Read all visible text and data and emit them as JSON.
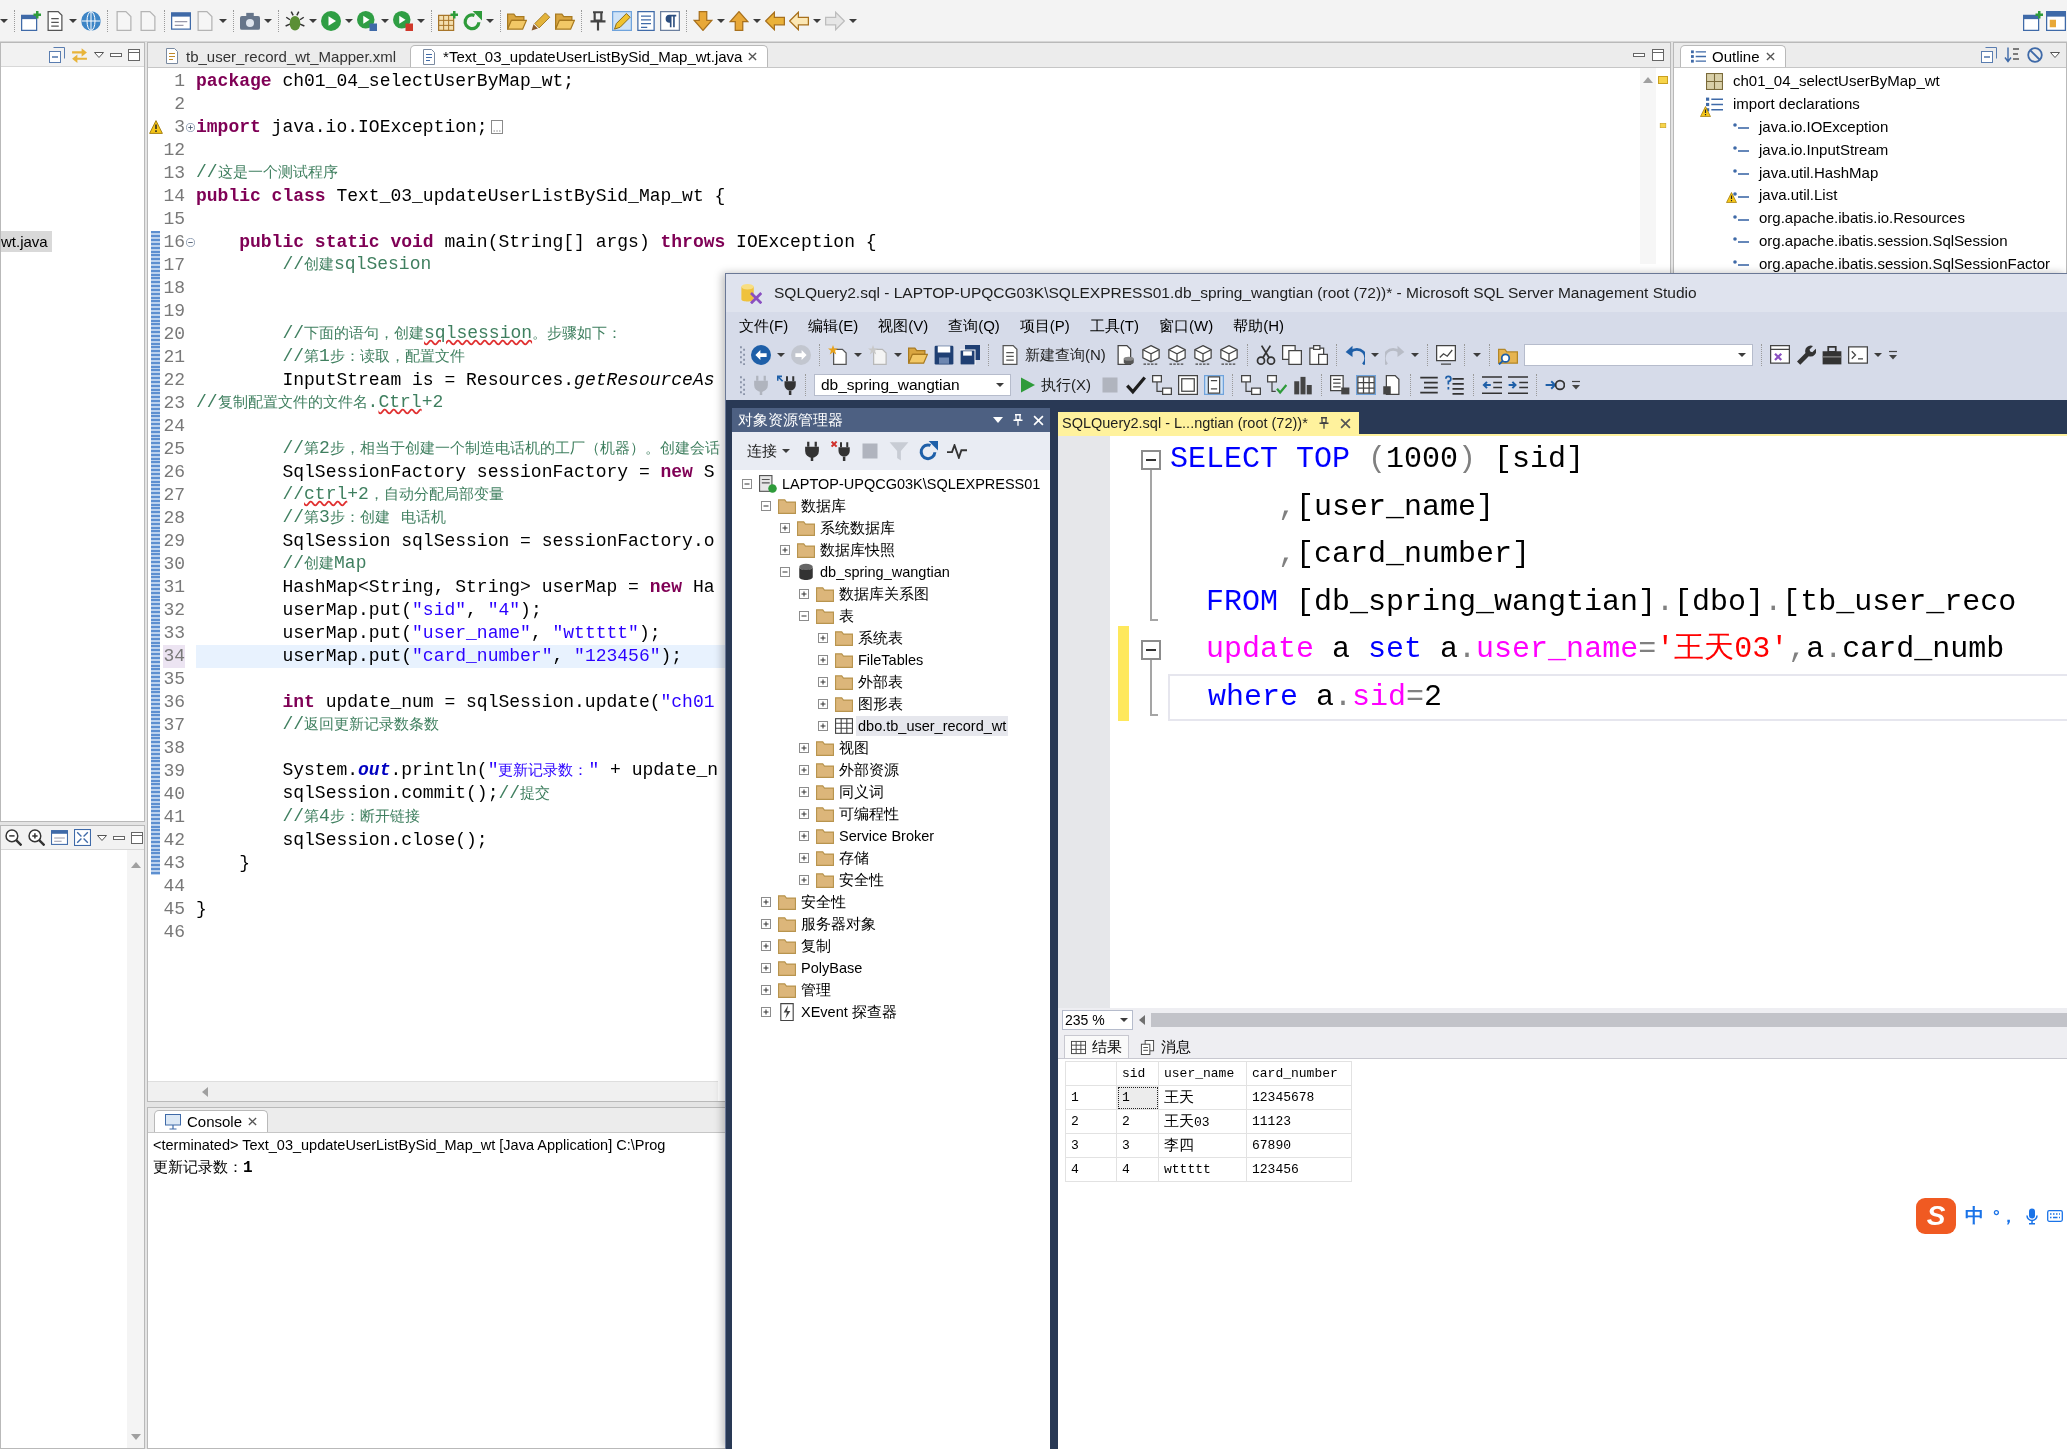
{
  "eclipse": {
    "toolbar": {
      "mark_occurrences": true
    },
    "package_explorer": {
      "items": [
        {
          "label": "wt.java",
          "selected": true
        }
      ]
    },
    "editor": {
      "tabs": [
        {
          "label": "tb_user_record_wt_Mapper.xml",
          "selected": false
        },
        {
          "label": "*Text_03_updateUserListBySid_Map_wt.java",
          "selected": true
        }
      ],
      "lines": [
        {
          "number": "1",
          "kind": "plain",
          "tokens": [
            {
              "kind": "kw",
              "text": "package"
            },
            {
              "kind": "pl",
              "text": " ch01_04_selectUserByMap_wt;"
            }
          ],
          "warning": false,
          "changed": false,
          "current": false
        },
        {
          "number": "2",
          "kind": "plain",
          "warning": false,
          "changed": false,
          "current": false
        },
        {
          "number": "3",
          "kind": "folded",
          "tokens": [
            {
              "kind": "kw",
              "text": "import"
            },
            {
              "kind": "pl",
              "text": " java.io.IOException;"
            }
          ],
          "warning": true,
          "changed": false,
          "current": false
        },
        {
          "number": "12",
          "kind": "plain",
          "warning": false,
          "changed": false,
          "current": false
        },
        {
          "number": "13",
          "kind": "plain",
          "tokens": [
            {
              "kind": "cm",
              "text": "//这是一个测试程序"
            }
          ],
          "warning": false,
          "changed": false,
          "current": false
        },
        {
          "number": "14",
          "kind": "plain",
          "tokens": [
            {
              "kind": "kw",
              "text": "public class"
            },
            {
              "kind": "pl",
              "text": " Text_03_updateUserListBySid_Map_wt {"
            }
          ],
          "warning": false,
          "changed": false,
          "current": false
        },
        {
          "number": "15",
          "kind": "plain",
          "warning": false,
          "changed": false,
          "current": false
        },
        {
          "number": "16",
          "kind": "fold",
          "tokens": [
            {
              "kind": "kw",
              "text": "    public static void"
            },
            {
              "kind": "pl",
              "text": " main(String[] args) "
            },
            {
              "kind": "kw",
              "text": "throws"
            },
            {
              "kind": "pl",
              "text": " IOException {"
            }
          ],
          "warning": false,
          "changed": true,
          "current": false
        },
        {
          "number": "17",
          "kind": "plain",
          "tokens": [
            {
              "kind": "cm",
              "text": "        //创建sqlSesion"
            }
          ],
          "warning": false,
          "changed": true,
          "current": false
        },
        {
          "number": "18",
          "kind": "plain",
          "warning": false,
          "changed": true,
          "current": false
        },
        {
          "number": "19",
          "kind": "plain",
          "warning": false,
          "changed": true,
          "current": false
        },
        {
          "number": "20",
          "kind": "plain",
          "tokens": [
            {
              "kind": "cm",
              "text": "        //下面的语句，创建"
            },
            {
              "kind": "spell",
              "text": "sqlsession"
            },
            {
              "kind": "cm",
              "text": "。步骤如下："
            }
          ],
          "warning": false,
          "changed": true,
          "current": false
        },
        {
          "number": "21",
          "kind": "plain",
          "tokens": [
            {
              "kind": "cm",
              "text": "        //第1步：读取，配置文件"
            }
          ],
          "warning": false,
          "changed": true,
          "current": false
        },
        {
          "number": "22",
          "kind": "plain",
          "tokens": [
            {
              "kind": "pl",
              "text": "        InputStream is = Resources."
            },
            {
              "kind": "it",
              "text": "getResourceAs"
            }
          ],
          "warning": false,
          "changed": true,
          "current": false
        },
        {
          "number": "23",
          "kind": "plain",
          "tokens": [
            {
              "kind": "cm",
              "text": "//复制配置文件的文件名."
            },
            {
              "kind": "spell",
              "text": "Ctrl"
            },
            {
              "kind": "cm",
              "text": "+2"
            }
          ],
          "warning": false,
          "changed": true,
          "current": false
        },
        {
          "number": "24",
          "kind": "plain",
          "warning": false,
          "changed": true,
          "current": false
        },
        {
          "number": "25",
          "kind": "plain",
          "tokens": [
            {
              "kind": "cm",
              "text": "        //第2步，相当于创建一个制造电话机的工厂（机器）。创建会话"
            }
          ],
          "warning": false,
          "changed": true,
          "current": false
        },
        {
          "number": "26",
          "kind": "plain",
          "tokens": [
            {
              "kind": "pl",
              "text": "        SqlSessionFactory sessionFactory = "
            },
            {
              "kind": "kw",
              "text": "new"
            },
            {
              "kind": "pl",
              "text": " S"
            }
          ],
          "warning": false,
          "changed": true,
          "current": false
        },
        {
          "number": "27",
          "kind": "plain",
          "tokens": [
            {
              "kind": "cm",
              "text": "        //"
            },
            {
              "kind": "spell",
              "text": "ctrl"
            },
            {
              "kind": "cm",
              "text": "+2，自动分配局部变量"
            }
          ],
          "warning": false,
          "changed": true,
          "current": false
        },
        {
          "number": "28",
          "kind": "plain",
          "tokens": [
            {
              "kind": "cm",
              "text": "        //第3步：创建 电话机"
            }
          ],
          "warning": false,
          "changed": true,
          "current": false
        },
        {
          "number": "29",
          "kind": "plain",
          "tokens": [
            {
              "kind": "pl",
              "text": "        SqlSession sqlSession = sessionFactory.o"
            }
          ],
          "warning": false,
          "changed": true,
          "current": false
        },
        {
          "number": "30",
          "kind": "plain",
          "tokens": [
            {
              "kind": "cm",
              "text": "        //创建Map"
            }
          ],
          "warning": false,
          "changed": true,
          "current": false
        },
        {
          "number": "31",
          "kind": "plain",
          "tokens": [
            {
              "kind": "pl",
              "text": "        HashMap<String, String> userMap = "
            },
            {
              "kind": "kw",
              "text": "new"
            },
            {
              "kind": "pl",
              "text": " Ha"
            }
          ],
          "warning": false,
          "changed": true,
          "current": false
        },
        {
          "number": "32",
          "kind": "plain",
          "tokens": [
            {
              "kind": "pl",
              "text": "        userMap.put("
            },
            {
              "kind": "str",
              "text": "\"sid\""
            },
            {
              "kind": "pl",
              "text": ", "
            },
            {
              "kind": "str",
              "text": "\"4\""
            },
            {
              "kind": "pl",
              "text": ");"
            }
          ],
          "warning": false,
          "changed": true,
          "current": false
        },
        {
          "number": "33",
          "kind": "plain",
          "tokens": [
            {
              "kind": "pl",
              "text": "        userMap.put("
            },
            {
              "kind": "str",
              "text": "\"user_name\""
            },
            {
              "kind": "pl",
              "text": ", "
            },
            {
              "kind": "str",
              "text": "\"wttttt\""
            },
            {
              "kind": "pl",
              "text": ");"
            }
          ],
          "warning": false,
          "changed": true,
          "current": false
        },
        {
          "number": "34",
          "kind": "plain",
          "tokens": [
            {
              "kind": "pl",
              "text": "        userMap.put("
            },
            {
              "kind": "str",
              "text": "\"card_number\""
            },
            {
              "kind": "pl",
              "text": ", "
            },
            {
              "kind": "str",
              "text": "\"123456\""
            },
            {
              "kind": "pl",
              "text": ");"
            }
          ],
          "warning": false,
          "changed": true,
          "current": true
        },
        {
          "number": "35",
          "kind": "plain",
          "warning": false,
          "changed": true,
          "current": false
        },
        {
          "number": "36",
          "kind": "plain",
          "tokens": [
            {
              "kind": "kw",
              "text": "        int"
            },
            {
              "kind": "pl",
              "text": " update_num = sqlSession.update("
            },
            {
              "kind": "str",
              "text": "\"ch01"
            }
          ],
          "warning": false,
          "changed": true,
          "current": false
        },
        {
          "number": "37",
          "kind": "plain",
          "tokens": [
            {
              "kind": "cm",
              "text": "        //返回更新记录数条数"
            }
          ],
          "warning": false,
          "changed": true,
          "current": false
        },
        {
          "number": "38",
          "kind": "plain",
          "warning": false,
          "changed": true,
          "current": false
        },
        {
          "number": "39",
          "kind": "plain",
          "tokens": [
            {
              "kind": "pl",
              "text": "        System."
            },
            {
              "kind": "fld",
              "text": "out"
            },
            {
              "kind": "pl",
              "text": ".println("
            },
            {
              "kind": "str",
              "text": "\"更新记录数：\""
            },
            {
              "kind": "pl",
              "text": " + update_n"
            }
          ],
          "warning": false,
          "changed": true,
          "current": false
        },
        {
          "number": "40",
          "kind": "plain",
          "tokens": [
            {
              "kind": "pl",
              "text": "        sqlSession.commit();"
            },
            {
              "kind": "cm",
              "text": "//提交"
            }
          ],
          "warning": false,
          "changed": true,
          "current": false
        },
        {
          "number": "41",
          "kind": "plain",
          "tokens": [
            {
              "kind": "cm",
              "text": "        //第4步：断开链接"
            }
          ],
          "warning": false,
          "changed": true,
          "current": false
        },
        {
          "number": "42",
          "kind": "plain",
          "tokens": [
            {
              "kind": "pl",
              "text": "        sqlSession.close();"
            }
          ],
          "warning": false,
          "changed": true,
          "current": false
        },
        {
          "number": "43",
          "kind": "plain",
          "tokens": [
            {
              "kind": "pl",
              "text": "    }"
            }
          ],
          "warning": false,
          "changed": true,
          "current": false
        },
        {
          "number": "44",
          "kind": "plain",
          "warning": false,
          "changed": false,
          "current": false
        },
        {
          "number": "45",
          "kind": "plain",
          "tokens": [
            {
              "kind": "pl",
              "text": "}"
            }
          ],
          "warning": false,
          "changed": false,
          "current": false
        },
        {
          "number": "46",
          "kind": "plain",
          "warning": false,
          "changed": false,
          "current": false
        }
      ]
    },
    "console": {
      "tab": "Console",
      "status": "<terminated> Text_03_updateUserListBySid_Map_wt [Java Application] C:\\Prog",
      "output": "更新记录数：1"
    },
    "outline": {
      "title": "Outline",
      "items": [
        {
          "label": "ch01_04_selectUserByMap_wt",
          "kind": "package",
          "warning": false
        },
        {
          "label": "import declarations",
          "kind": "imports",
          "warning": true,
          "children": [
            {
              "label": "java.io.IOException",
              "kind": "import",
              "warning": false
            },
            {
              "label": "java.io.InputStream",
              "kind": "import",
              "warning": false
            },
            {
              "label": "java.util.HashMap",
              "kind": "import",
              "warning": false
            },
            {
              "label": "java.util.List",
              "kind": "import",
              "warning": true
            },
            {
              "label": "org.apache.ibatis.io.Resources",
              "kind": "import",
              "warning": false
            },
            {
              "label": "org.apache.ibatis.session.SqlSession",
              "kind": "import",
              "warning": false
            },
            {
              "label": "org.apache.ibatis.session.SqlSessionFactor",
              "kind": "import",
              "warning": false
            }
          ]
        }
      ]
    }
  },
  "ssms": {
    "title": "SQLQuery2.sql - LAPTOP-UPQCG03K\\SQLEXPRESS01.db_spring_wangtian (root (72))* - Microsoft SQL Server Management Studio",
    "menu": [
      "文件(F)",
      "编辑(E)",
      "视图(V)",
      "查询(Q)",
      "项目(P)",
      "工具(T)",
      "窗口(W)",
      "帮助(H)"
    ],
    "standard_toolbar": {
      "new_query": "新建查询(N)"
    },
    "query_toolbar": {
      "database": "db_spring_wangtian",
      "execute": "执行(X)",
      "intellisense": true,
      "results_to_grid": true
    },
    "object_explorer": {
      "title": "对象资源管理器",
      "connect": "连接",
      "tree": [
        {
          "label": "LAPTOP-UPQCG03K\\SQLEXPRESS01",
          "kind": "server",
          "expanded": true,
          "selected": false,
          "children": [
            {
              "label": "数据库",
              "kind": "folder",
              "expanded": true,
              "selected": false,
              "children": [
                {
                  "label": "系统数据库",
                  "kind": "folder",
                  "expanded": false,
                  "selected": false
                },
                {
                  "label": "数据库快照",
                  "kind": "folder",
                  "expanded": false,
                  "selected": false
                },
                {
                  "label": "db_spring_wangtian",
                  "kind": "database",
                  "expanded": true,
                  "selected": false,
                  "children": [
                    {
                      "label": "数据库关系图",
                      "kind": "folder",
                      "expanded": false,
                      "selected": false
                    },
                    {
                      "label": "表",
                      "kind": "folder",
                      "expanded": true,
                      "selected": false,
                      "children": [
                        {
                          "label": "系统表",
                          "kind": "folder",
                          "expanded": false,
                          "selected": false
                        },
                        {
                          "label": "FileTables",
                          "kind": "folder",
                          "expanded": false,
                          "selected": false
                        },
                        {
                          "label": "外部表",
                          "kind": "folder",
                          "expanded": false,
                          "selected": false
                        },
                        {
                          "label": "图形表",
                          "kind": "folder",
                          "expanded": false,
                          "selected": false
                        },
                        {
                          "label": "dbo.tb_user_record_wt",
                          "kind": "table",
                          "expanded": false,
                          "selected": true
                        }
                      ]
                    },
                    {
                      "label": "视图",
                      "kind": "folder",
                      "expanded": false,
                      "selected": false
                    },
                    {
                      "label": "外部资源",
                      "kind": "folder",
                      "expanded": false,
                      "selected": false
                    },
                    {
                      "label": "同义词",
                      "kind": "folder",
                      "expanded": false,
                      "selected": false
                    },
                    {
                      "label": "可编程性",
                      "kind": "folder",
                      "expanded": false,
                      "selected": false
                    },
                    {
                      "label": "Service Broker",
                      "kind": "folder",
                      "expanded": false,
                      "selected": false
                    },
                    {
                      "label": "存储",
                      "kind": "folder",
                      "expanded": false,
                      "selected": false
                    },
                    {
                      "label": "安全性",
                      "kind": "folder",
                      "expanded": false,
                      "selected": false
                    }
                  ]
                }
              ]
            },
            {
              "label": "安全性",
              "kind": "folder",
              "expanded": false,
              "selected": false
            },
            {
              "label": "服务器对象",
              "kind": "folder",
              "expanded": false,
              "selected": false
            },
            {
              "label": "复制",
              "kind": "folder",
              "expanded": false,
              "selected": false
            },
            {
              "label": "PolyBase",
              "kind": "folder",
              "expanded": false,
              "selected": false
            },
            {
              "label": "管理",
              "kind": "folder",
              "expanded": false,
              "selected": false
            },
            {
              "label": "XEvent 探查器",
              "kind": "events",
              "expanded": false,
              "selected": false
            }
          ]
        }
      ]
    },
    "document": {
      "tab": {
        "label": "SQLQuery2.sql - L...ngtian (root (72))*",
        "selected": true
      },
      "lines": [
        {
          "kind": "fold",
          "tokens": [
            {
              "kind": "kw",
              "text": "SELECT TOP"
            },
            {
              "kind": "op",
              "text": " ("
            },
            {
              "kind": "pl",
              "text": "1000"
            },
            {
              "kind": "op",
              "text": ")"
            },
            {
              "kind": "pl",
              "text": " [sid]"
            }
          ],
          "changed": false,
          "current": false
        },
        {
          "kind": "plain",
          "tokens": [
            {
              "kind": "op",
              "text": "      ,"
            },
            {
              "kind": "pl",
              "text": "[user_name]"
            }
          ],
          "changed": false,
          "current": false
        },
        {
          "kind": "plain",
          "tokens": [
            {
              "kind": "op",
              "text": "      ,"
            },
            {
              "kind": "pl",
              "text": "[card_number]"
            }
          ],
          "changed": false,
          "current": false
        },
        {
          "kind": "plain",
          "tokens": [
            {
              "kind": "kw",
              "text": "  FROM"
            },
            {
              "kind": "pl",
              "text": " [db_spring_wangtian]"
            },
            {
              "kind": "op",
              "text": "."
            },
            {
              "kind": "pl",
              "text": "[dbo]"
            },
            {
              "kind": "op",
              "text": "."
            },
            {
              "kind": "pl",
              "text": "[tb_user_reco"
            }
          ],
          "changed": false,
          "current": false
        },
        {
          "kind": "fold",
          "tokens": [
            {
              "kind": "fn",
              "text": "  update"
            },
            {
              "kind": "pl",
              "text": " a "
            },
            {
              "kind": "kw",
              "text": "set"
            },
            {
              "kind": "pl",
              "text": " a"
            },
            {
              "kind": "op",
              "text": "."
            },
            {
              "kind": "fn",
              "text": "user_name"
            },
            {
              "kind": "op",
              "text": "="
            },
            {
              "kind": "str",
              "text": "'王天03'"
            },
            {
              "kind": "op",
              "text": ","
            },
            {
              "kind": "pl",
              "text": "a"
            },
            {
              "kind": "op",
              "text": "."
            },
            {
              "kind": "pl",
              "text": "card_numb"
            }
          ],
          "changed": true,
          "current": false
        },
        {
          "kind": "plain",
          "tokens": [
            {
              "kind": "kw",
              "text": "  where"
            },
            {
              "kind": "pl",
              "text": " a"
            },
            {
              "kind": "op",
              "text": "."
            },
            {
              "kind": "fn",
              "text": "sid"
            },
            {
              "kind": "op",
              "text": "="
            },
            {
              "kind": "pl",
              "text": "2"
            }
          ],
          "changed": true,
          "current": true
        }
      ],
      "zoom": "235 %"
    },
    "results": {
      "tabs": [
        {
          "label": "结果",
          "kind": "grid",
          "selected": true
        },
        {
          "label": "消息",
          "kind": "messages",
          "selected": false
        }
      ],
      "columns": [
        "sid",
        "user_name",
        "card_number"
      ],
      "rows": [
        {
          "number": "1",
          "cells": [
            "1",
            "王天",
            "12345678"
          ],
          "selected": true
        },
        {
          "number": "2",
          "cells": [
            "2",
            "王天03",
            "11123"
          ],
          "selected": false
        },
        {
          "number": "3",
          "cells": [
            "3",
            "李四",
            "67890"
          ],
          "selected": false
        },
        {
          "number": "4",
          "cells": [
            "4",
            "wttttt",
            "123456"
          ],
          "selected": false
        }
      ]
    },
    "ime": {
      "logo": "S",
      "mode": "中",
      "punctuation": "°，"
    }
  }
}
